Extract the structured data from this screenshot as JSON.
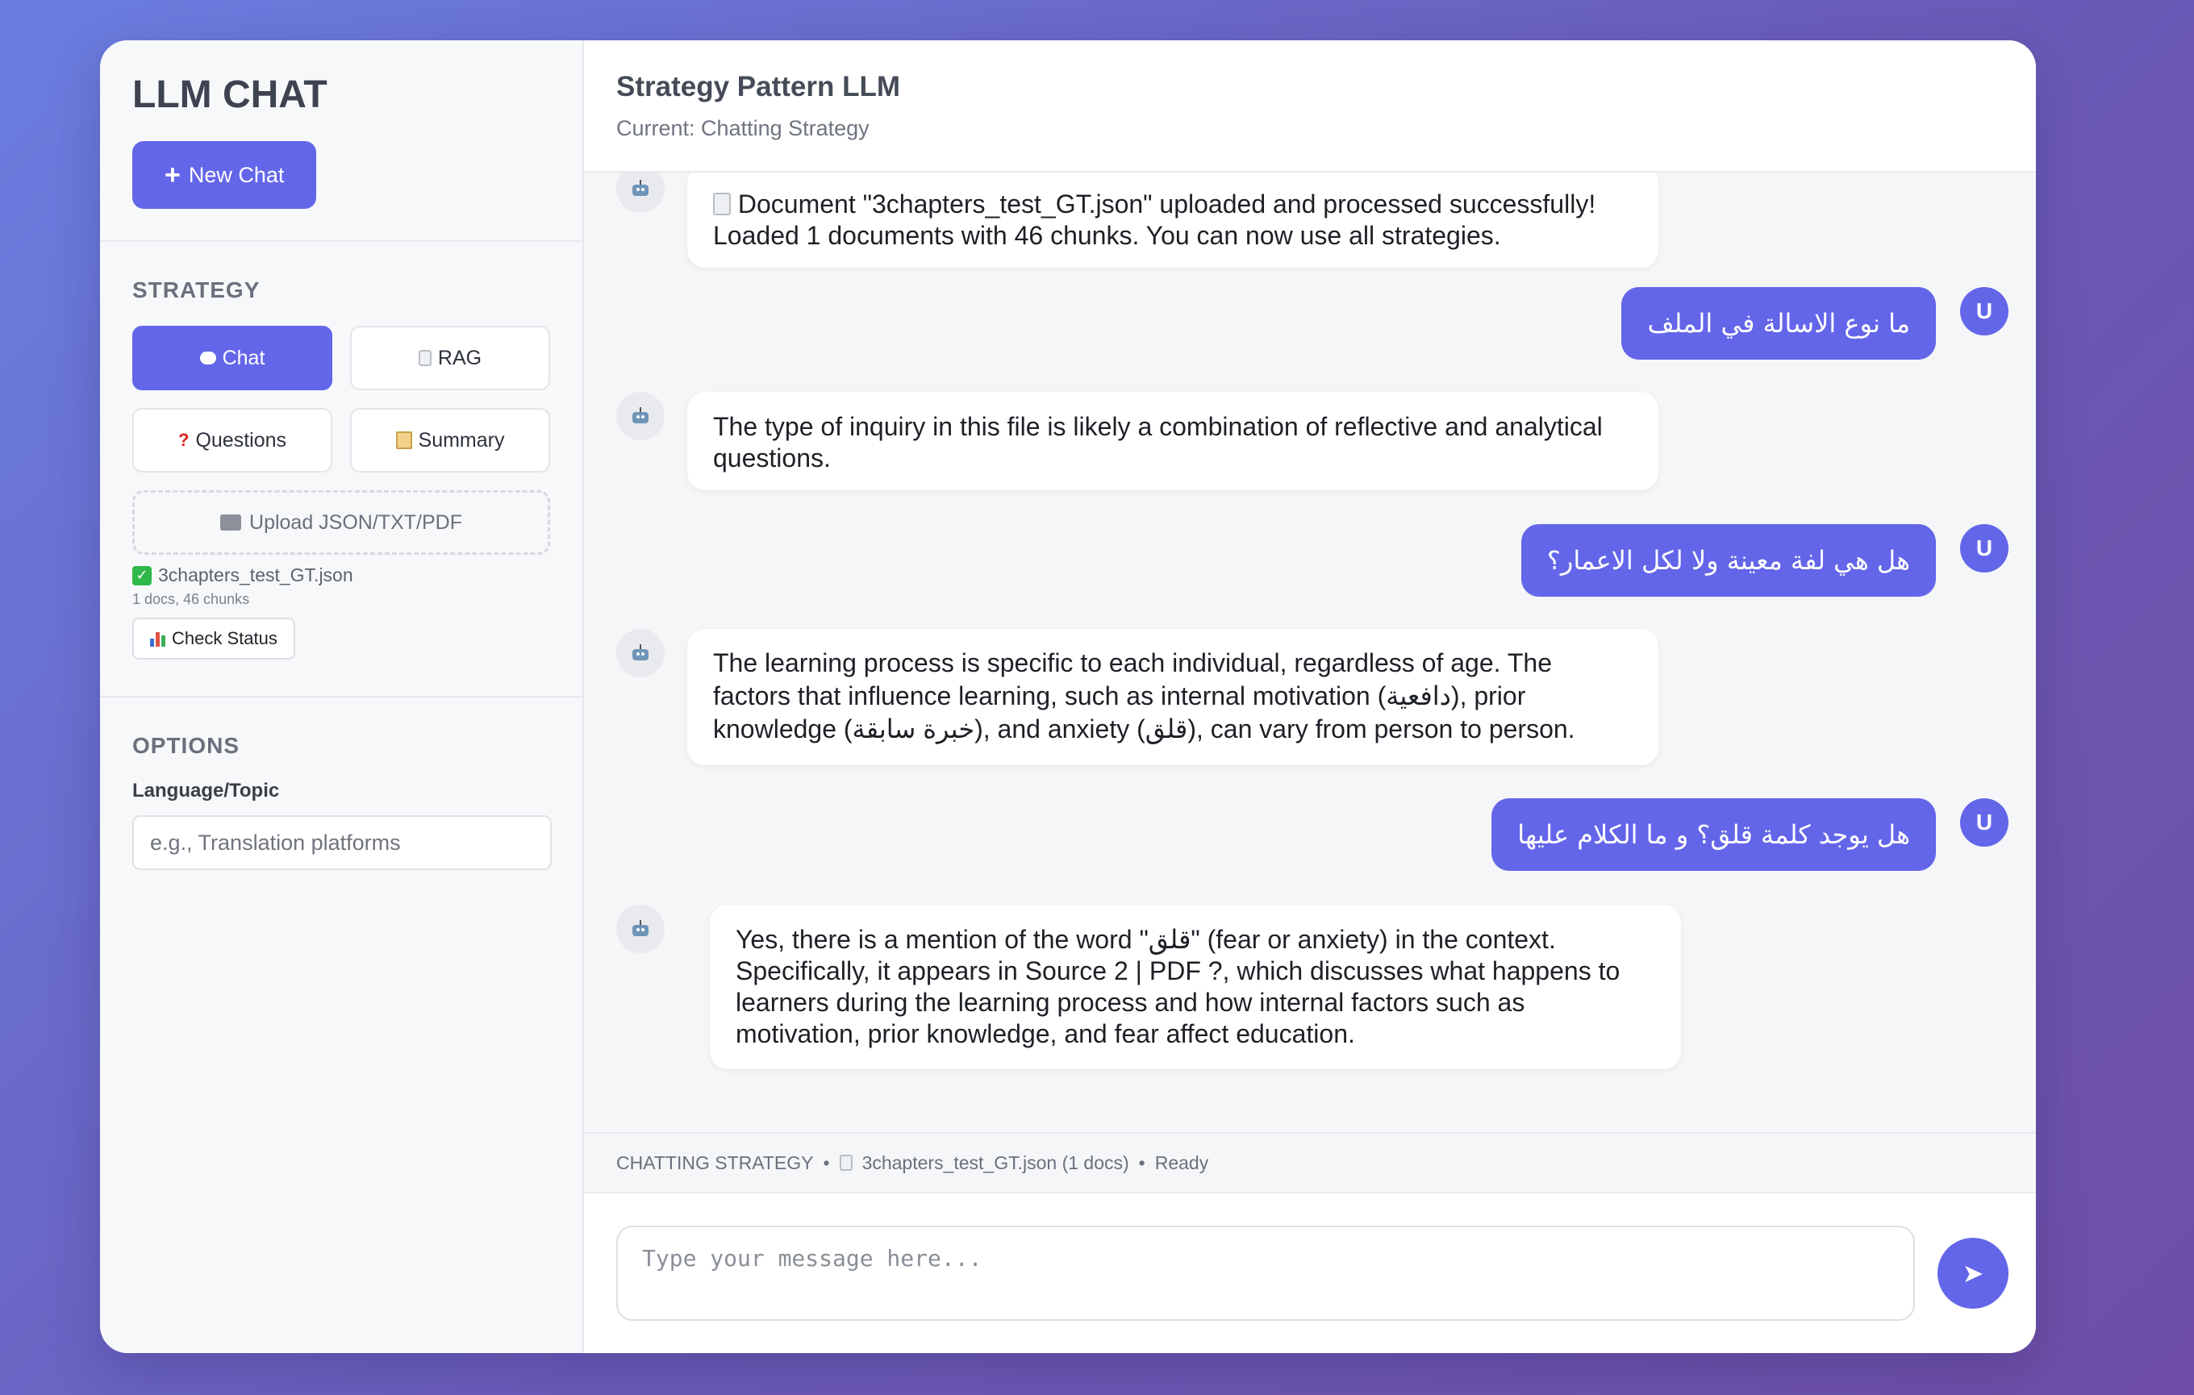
{
  "sidebar": {
    "brand": "LLM CHAT",
    "new_chat_label": "New Chat",
    "strategy_title": "STRATEGY",
    "strategies": [
      {
        "label": "Chat",
        "icon": "speech-bubble-icon",
        "active": true
      },
      {
        "label": "RAG",
        "icon": "document-icon",
        "active": false
      },
      {
        "label": "Questions",
        "icon": "question-mark-icon",
        "active": false
      },
      {
        "label": "Summary",
        "icon": "memo-icon",
        "active": false
      }
    ],
    "upload_label": "Upload JSON/TXT/PDF",
    "file_name": "3chapters_test_GT.json",
    "file_meta": "1 docs, 46 chunks",
    "check_status_label": "Check Status",
    "options_title": "OPTIONS",
    "language_label": "Language/Topic",
    "language_placeholder": "e.g., Translation platforms"
  },
  "header": {
    "title": "Strategy Pattern LLM",
    "subtitle": "Current: Chatting Strategy"
  },
  "messages": [
    {
      "role": "bot",
      "text": "Document \"3chapters_test_GT.json\" uploaded and processed successfully! Loaded 1 documents with 46 chunks. You can now use all strategies."
    },
    {
      "role": "user",
      "text": "ما نوع الاسالة في الملف"
    },
    {
      "role": "bot",
      "text": "The type of inquiry in this file is likely a combination of reflective and analytical questions."
    },
    {
      "role": "user",
      "text": "هل هي لفة معينة ولا لكل الاعمار؟"
    },
    {
      "role": "bot",
      "text": "The learning process is specific to each individual, regardless of age. The factors that influence learning, such as internal motivation (دافعية), prior knowledge (خبرة سابقة), and anxiety (قلق), can vary from person to person."
    },
    {
      "role": "user",
      "text": "هل يوجد كلمة قلق؟ و ما الكلام عليها"
    },
    {
      "role": "bot",
      "text": "Yes, there is a mention of the word \"قلق\" (fear or anxiety) in the context. Specifically, it appears in Source 2 | PDF ?, which discusses what happens to learners during the learning process and how internal factors such as motivation, prior knowledge, and fear affect education."
    }
  ],
  "user_avatar_letter": "U",
  "status_bar": {
    "strategy": "CHATTING STRATEGY",
    "file": "3chapters_test_GT.json (1 docs)",
    "state": "Ready",
    "separator": "•"
  },
  "composer": {
    "placeholder": "Type your message here...",
    "send_icon": "➤"
  },
  "colors": {
    "accent": "#6366e8",
    "background_gradient_start": "#6a7ee0",
    "background_gradient_end": "#6e4ea6"
  }
}
